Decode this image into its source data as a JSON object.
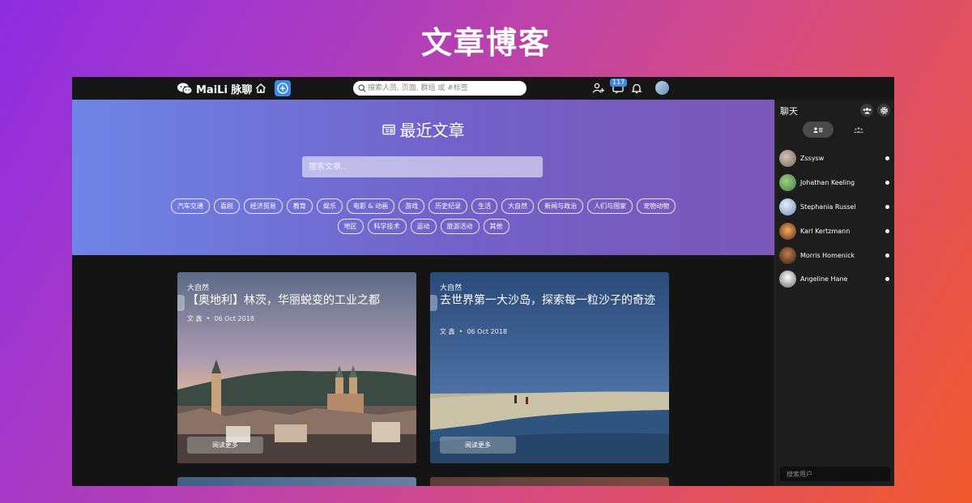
{
  "banner": {
    "title": "文章博客"
  },
  "nav": {
    "brand": "MaiLi 脉聊",
    "search_placeholder": "搜索人员, 页面, 群组 或 #标签",
    "notification_count": "117"
  },
  "hero": {
    "title": "最近文章",
    "search_placeholder": "搜索文章..",
    "tags": [
      "汽车交通",
      "喜剧",
      "经济贸易",
      "教育",
      "娱乐",
      "电影 & 动画",
      "游戏",
      "历史纪录",
      "生活",
      "大自然",
      "新闻与政治",
      "人们与国家",
      "宠物动物",
      "地区",
      "科学技术",
      "运动",
      "旅游活动",
      "其他"
    ]
  },
  "articles": [
    {
      "category": "大自然",
      "title": "【奥地利】林茨，华丽蜕变的工业之都",
      "author": "文 鑫",
      "date": "06 Oct 2018",
      "read_more": "阅读更多"
    },
    {
      "category": "大自然",
      "title": "去世界第一大沙岛，探索每一粒沙子的奇迹",
      "author": "文 鑫",
      "date": "06 Oct 2018",
      "read_more": "阅读更多"
    }
  ],
  "chat": {
    "title": "聊天",
    "users": [
      {
        "name": "Zssysw"
      },
      {
        "name": "Johathan Keeling"
      },
      {
        "name": "Stephania Russel"
      },
      {
        "name": "Karl Kertzmann"
      },
      {
        "name": "Morris Homenick"
      },
      {
        "name": "Angeline Hane"
      }
    ],
    "search_placeholder": "搜索用户"
  },
  "colors": {
    "accent": "#3d8ae8",
    "app_bg": "#141414",
    "panel_bg": "#1d1d1d"
  }
}
